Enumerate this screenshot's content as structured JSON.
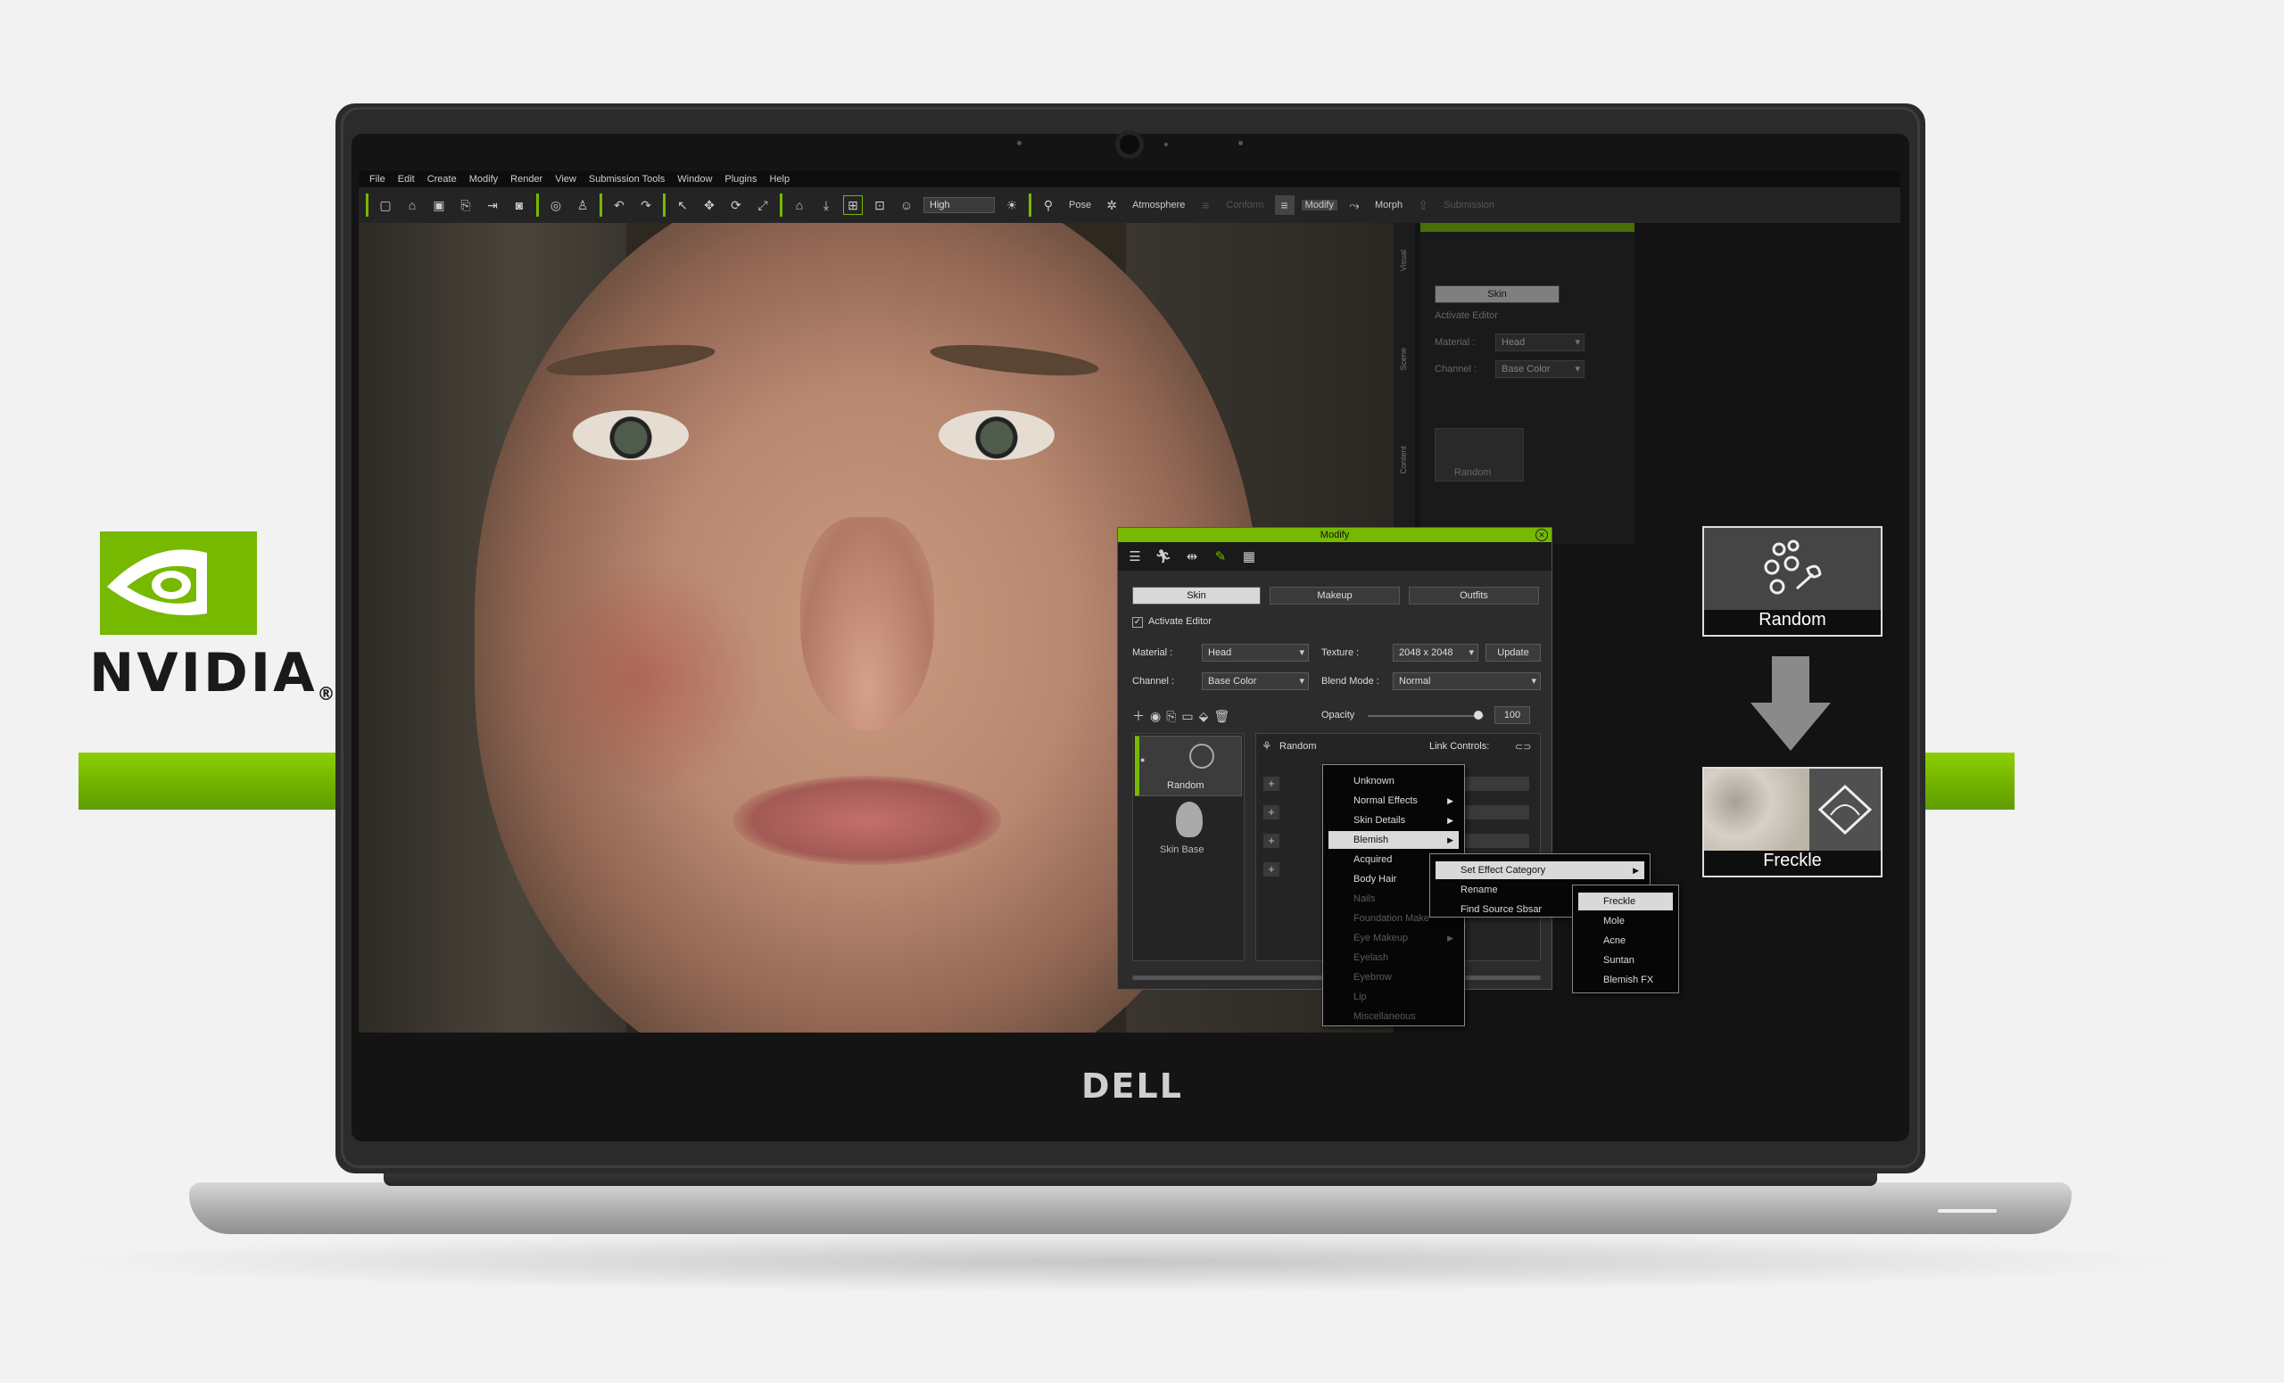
{
  "brand": {
    "nvidia_word": "NVIDIA",
    "nvidia_reg": "®",
    "laptop_logo": "DELL",
    "accent": "#76b900"
  },
  "menubar": [
    "File",
    "Edit",
    "Create",
    "Modify",
    "Render",
    "View",
    "Submission Tools",
    "Window",
    "Plugins",
    "Help"
  ],
  "toolbar": {
    "quality": "High",
    "buttons": [
      "Pose",
      "Atmosphere",
      "Modify",
      "Morph"
    ],
    "faded": [
      "Conform",
      "Submission"
    ]
  },
  "dock": {
    "vtabs": [
      "Visual",
      "Scene",
      "Content"
    ],
    "ghost": {
      "skin": "Skin",
      "activate": "Activate Editor",
      "material_label": "Material :",
      "material": "Head",
      "channel_label": "Channel :",
      "channel": "Base Color",
      "random": "Random"
    }
  },
  "panel": {
    "title": "Modify",
    "tabs": [
      "Skin",
      "Makeup",
      "Outfits"
    ],
    "activate_editor": "Activate Editor",
    "material_label": "Material :",
    "material": "Head",
    "texture_label": "Texture :",
    "texture": "2048 x 2048",
    "update": "Update",
    "channel_label": "Channel :",
    "channel": "Base Color",
    "blend_label": "Blend Mode :",
    "blend": "Normal",
    "opacity_label": "Opacity",
    "opacity": "100",
    "opacity_level": 0.95,
    "layer_random": "Random",
    "layer_skin_base": "Skin Base",
    "effect_name": "Random",
    "link_controls": "Link Controls:"
  },
  "menu_category": {
    "items": [
      {
        "label": "Unknown"
      },
      {
        "label": "Normal Effects",
        "sub": true
      },
      {
        "label": "Skin Details",
        "sub": true
      },
      {
        "label": "Blemish",
        "sub": true,
        "hl": true
      },
      {
        "label": "Acquired"
      },
      {
        "label": "Body Hair"
      },
      {
        "label": "Nails",
        "dim": true
      },
      {
        "label": "Foundation Make",
        "dim": true
      },
      {
        "label": "Eye Makeup",
        "sub": true,
        "dim": true
      },
      {
        "label": "Eyelash",
        "dim": true
      },
      {
        "label": "Eyebrow",
        "dim": true
      },
      {
        "label": "Lip",
        "dim": true
      },
      {
        "label": "Miscellaneous",
        "dim": true
      }
    ]
  },
  "menu_effect": {
    "items": [
      {
        "label": "Set Effect Category",
        "sub": true,
        "hl": true
      },
      {
        "label": "Rename"
      },
      {
        "label": "Find Source Sbsar"
      }
    ]
  },
  "menu_blemish": {
    "items": [
      {
        "label": "Freckle",
        "hl": true
      },
      {
        "label": "Mole"
      },
      {
        "label": "Acne"
      },
      {
        "label": "Suntan"
      },
      {
        "label": "Blemish FX"
      }
    ]
  },
  "callouts": {
    "top": "Random",
    "bottom": "Freckle"
  }
}
